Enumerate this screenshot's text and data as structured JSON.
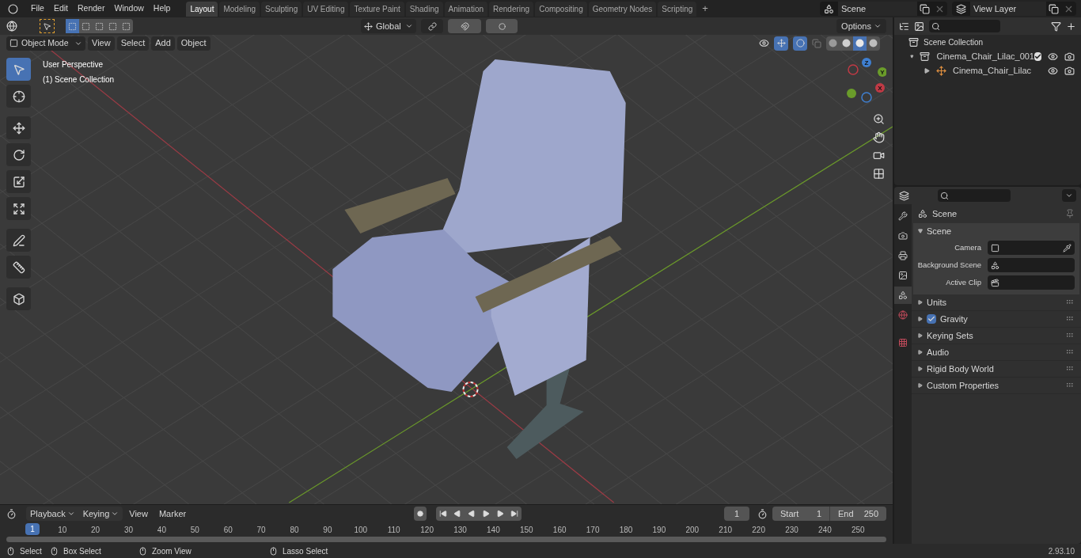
{
  "menu": [
    "File",
    "Edit",
    "Render",
    "Window",
    "Help"
  ],
  "workspaces": [
    {
      "label": "Layout",
      "selected": true
    },
    {
      "label": "Modeling",
      "selected": false
    },
    {
      "label": "Sculpting",
      "selected": false
    },
    {
      "label": "UV Editing",
      "selected": false
    },
    {
      "label": "Texture Paint",
      "selected": false
    },
    {
      "label": "Shading",
      "selected": false
    },
    {
      "label": "Animation",
      "selected": false
    },
    {
      "label": "Rendering",
      "selected": false
    },
    {
      "label": "Compositing",
      "selected": false
    },
    {
      "label": "Geometry Nodes",
      "selected": false
    },
    {
      "label": "Scripting",
      "selected": false
    }
  ],
  "add_workspace": "+",
  "scene_field": "Scene",
  "view_layer_field": "View Layer",
  "viewport": {
    "select_modes": [
      {
        "selected": true
      },
      {
        "selected": false
      },
      {
        "selected": false
      },
      {
        "selected": false
      },
      {
        "selected": false
      }
    ],
    "transform_orientation": "Global",
    "snapping": {
      "on": false
    },
    "proportional_editing": {
      "on": false
    },
    "options": "Options",
    "mode": "Object Mode",
    "menus": [
      "View",
      "Select",
      "Add",
      "Object"
    ],
    "shading": [
      {
        "kind": "wireframe",
        "selected": false
      },
      {
        "kind": "solid",
        "selected": false
      },
      {
        "kind": "material",
        "selected": true
      },
      {
        "kind": "rendered",
        "selected": false
      }
    ],
    "overlay_text": [
      "User Perspective",
      "(1) Scene Collection"
    ],
    "tools": [
      {
        "kind": "select",
        "selected": true
      },
      {
        "kind": "cursor",
        "selected": false
      },
      {
        "kind": "move",
        "selected": false
      },
      {
        "kind": "rotate",
        "selected": false
      },
      {
        "kind": "scale",
        "selected": false
      },
      {
        "kind": "transform",
        "selected": false
      },
      {
        "kind": "annotate",
        "selected": false
      },
      {
        "kind": "measure",
        "selected": false
      },
      {
        "kind": "add_cube",
        "selected": false
      }
    ],
    "gizmo_axes": [
      "Z",
      "Y",
      "X"
    ]
  },
  "outliner": {
    "root": "Scene Collection",
    "items": [
      {
        "label": "Cinema_Chair_Lilac_001",
        "kind": "collection",
        "expanded": true,
        "checked": true,
        "children": [
          {
            "label": "Cinema_Chair_Lilac",
            "kind": "object",
            "expanded": false
          }
        ]
      }
    ]
  },
  "properties": {
    "tabs": [
      {
        "kind": "tool",
        "selected": false
      },
      {
        "kind": "render",
        "selected": false
      },
      {
        "kind": "output",
        "selected": false
      },
      {
        "kind": "view_layer",
        "selected": false
      },
      {
        "kind": "scene",
        "selected": true
      },
      {
        "kind": "world",
        "selected": false
      },
      {
        "kind": "texture",
        "selected": false
      }
    ],
    "context": "Scene",
    "panel": {
      "title": "Scene",
      "expanded": true,
      "fields": [
        {
          "label": "Camera",
          "kind": "camera"
        },
        {
          "label": "Background Scene",
          "kind": "scene"
        },
        {
          "label": "Active Clip",
          "kind": "clip"
        }
      ]
    },
    "subpanels": [
      {
        "title": "Units",
        "kind": "plain",
        "expanded": false
      },
      {
        "title": "Gravity",
        "kind": "checkbox",
        "checked": true,
        "expanded": false
      },
      {
        "title": "Keying Sets",
        "kind": "plain",
        "expanded": false
      },
      {
        "title": "Audio",
        "kind": "plain",
        "expanded": false
      },
      {
        "title": "Rigid Body World",
        "kind": "plain",
        "expanded": false
      },
      {
        "title": "Custom Properties",
        "kind": "plain",
        "expanded": false
      }
    ]
  },
  "timeline": {
    "menus": [
      "Playback",
      "Keying",
      "View",
      "Marker"
    ],
    "current_frame": "1",
    "start_label": "Start",
    "start": "1",
    "end_label": "End",
    "end": "250",
    "playhead": "1",
    "ruler": [
      "10",
      "20",
      "30",
      "40",
      "50",
      "60",
      "70",
      "80",
      "90",
      "100",
      "110",
      "120",
      "130",
      "140",
      "150",
      "160",
      "170",
      "180",
      "190",
      "200",
      "210",
      "220",
      "230",
      "240",
      "250"
    ]
  },
  "status_bar": {
    "hints": [
      "Select",
      "Box Select",
      "Zoom View",
      "Lasso Select"
    ],
    "version": "2.93.10"
  }
}
